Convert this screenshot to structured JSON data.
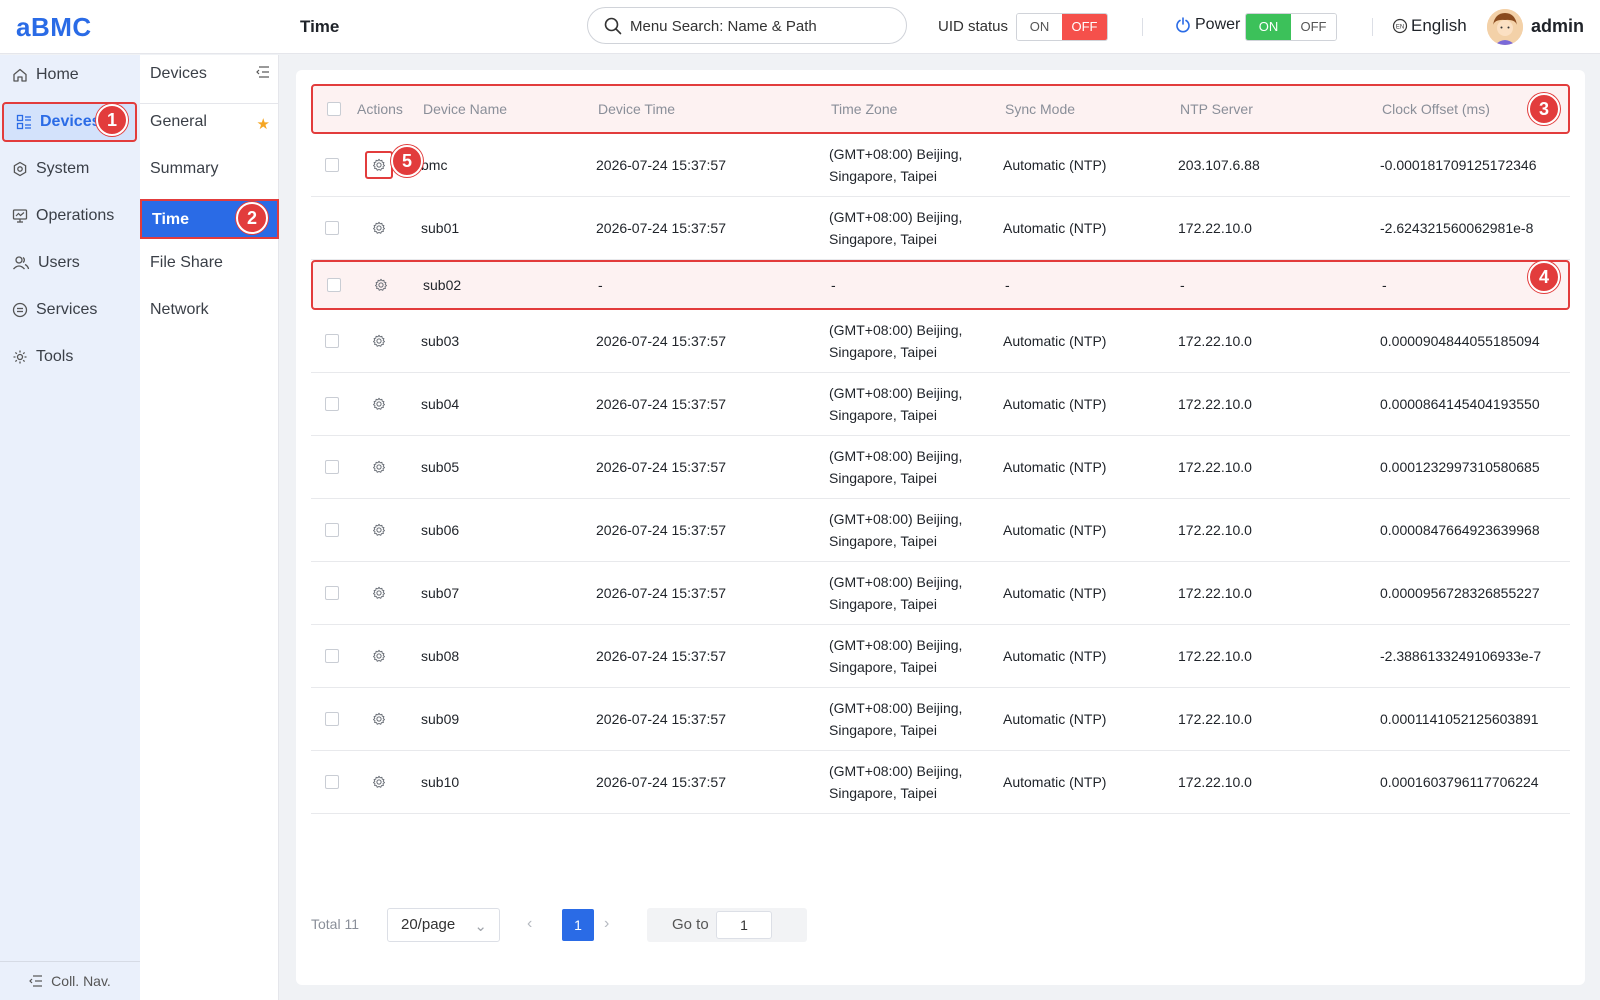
{
  "app": {
    "logo": "aBMC",
    "page_title": "Time"
  },
  "header": {
    "search_placeholder": "Menu Search: Name & Path",
    "uid_label": "UID status",
    "uid_on": "ON",
    "uid_off": "OFF",
    "uid_state": "OFF",
    "power_label": "Power",
    "power_on": "ON",
    "power_off": "OFF",
    "power_state": "ON",
    "language": "English",
    "user": "admin"
  },
  "nav1": {
    "items": [
      {
        "label": "Home",
        "icon": "home-icon"
      },
      {
        "label": "Devices",
        "icon": "devices-icon",
        "active": true
      },
      {
        "label": "System",
        "icon": "system-icon"
      },
      {
        "label": "Operations",
        "icon": "operations-icon"
      },
      {
        "label": "Users",
        "icon": "users-icon"
      },
      {
        "label": "Services",
        "icon": "services-icon"
      },
      {
        "label": "Tools",
        "icon": "tools-icon"
      }
    ],
    "collapse_label": "Coll. Nav."
  },
  "nav2": {
    "title": "Devices",
    "items": [
      {
        "label": "General",
        "starred": true
      },
      {
        "label": "Summary"
      },
      {
        "label": "Time",
        "active": true
      },
      {
        "label": "File Share"
      },
      {
        "label": "Network"
      }
    ]
  },
  "table": {
    "columns": [
      "Actions",
      "Device Name",
      "Device Time",
      "Time Zone",
      "Sync Mode",
      "NTP Server",
      "Clock Offset (ms)"
    ],
    "rows": [
      {
        "name": "bmc",
        "time": "2026-07-24 15:37:57",
        "tz": "(GMT+08:00) Beijing, Singapore, Taipei",
        "sync": "Automatic (NTP)",
        "ntp": "203.107.6.88",
        "offset": "-0.000181709125172346"
      },
      {
        "name": "sub01",
        "time": "2026-07-24 15:37:57",
        "tz": "(GMT+08:00) Beijing, Singapore, Taipei",
        "sync": "Automatic (NTP)",
        "ntp": "172.22.10.0",
        "offset": "-2.624321560062981e-8"
      },
      {
        "name": "sub02",
        "time": "-",
        "tz": "-",
        "sync": "-",
        "ntp": "-",
        "offset": "-"
      },
      {
        "name": "sub03",
        "time": "2026-07-24 15:37:57",
        "tz": "(GMT+08:00) Beijing, Singapore, Taipei",
        "sync": "Automatic (NTP)",
        "ntp": "172.22.10.0",
        "offset": "0.0000904844055185094"
      },
      {
        "name": "sub04",
        "time": "2026-07-24 15:37:57",
        "tz": "(GMT+08:00) Beijing, Singapore, Taipei",
        "sync": "Automatic (NTP)",
        "ntp": "172.22.10.0",
        "offset": "0.0000864145404193550"
      },
      {
        "name": "sub05",
        "time": "2026-07-24 15:37:57",
        "tz": "(GMT+08:00) Beijing, Singapore, Taipei",
        "sync": "Automatic (NTP)",
        "ntp": "172.22.10.0",
        "offset": "0.0001232997310580685"
      },
      {
        "name": "sub06",
        "time": "2026-07-24 15:37:57",
        "tz": "(GMT+08:00) Beijing, Singapore, Taipei",
        "sync": "Automatic (NTP)",
        "ntp": "172.22.10.0",
        "offset": "0.0000847664923639968"
      },
      {
        "name": "sub07",
        "time": "2026-07-24 15:37:57",
        "tz": "(GMT+08:00) Beijing, Singapore, Taipei",
        "sync": "Automatic (NTP)",
        "ntp": "172.22.10.0",
        "offset": "0.0000956728326855227"
      },
      {
        "name": "sub08",
        "time": "2026-07-24 15:37:57",
        "tz": "(GMT+08:00) Beijing, Singapore, Taipei",
        "sync": "Automatic (NTP)",
        "ntp": "172.22.10.0",
        "offset": "-2.3886133249106933e-7"
      },
      {
        "name": "sub09",
        "time": "2026-07-24 15:37:57",
        "tz": "(GMT+08:00) Beijing, Singapore, Taipei",
        "sync": "Automatic (NTP)",
        "ntp": "172.22.10.0",
        "offset": "0.0001141052125603891"
      },
      {
        "name": "sub10",
        "time": "2026-07-24 15:37:57",
        "tz": "(GMT+08:00) Beijing, Singapore, Taipei",
        "sync": "Automatic (NTP)",
        "ntp": "172.22.10.0",
        "offset": "0.0001603796117706224"
      }
    ]
  },
  "pagination": {
    "total": "Total 11",
    "page_size": "20/page",
    "current_page": "1",
    "goto_label": "Go to",
    "goto_value": "1"
  },
  "annotations": [
    "1",
    "2",
    "3",
    "4",
    "5"
  ],
  "colors": {
    "accent": "#2a6be6",
    "highlight": "#e23c3c",
    "off_red": "#f5504b",
    "on_green": "#3cc15a"
  }
}
